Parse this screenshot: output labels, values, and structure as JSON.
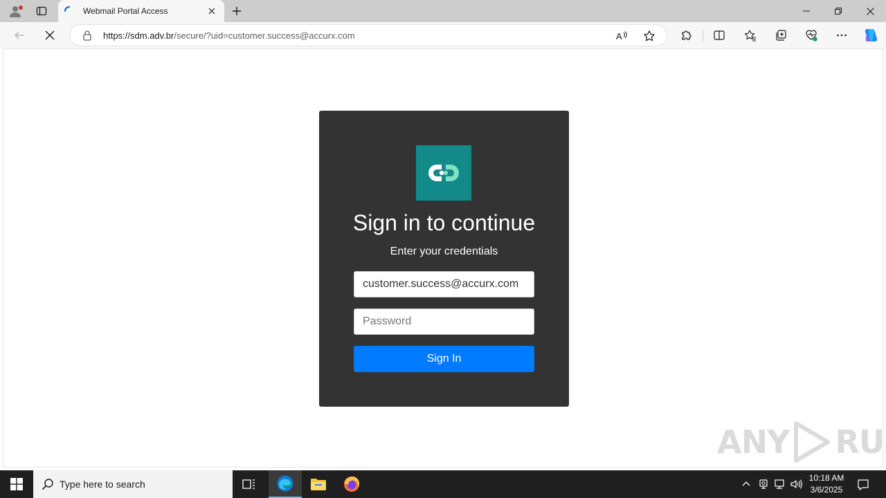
{
  "browser": {
    "tab_title": "Webmail Portal Access",
    "url_host": "https://sdm.adv.br",
    "url_path": "/secure/?uid=customer.success@accurx.com"
  },
  "page": {
    "heading": "Sign in to continue",
    "subheading": "Enter your credentials",
    "email_value": "customer.success@accurx.com",
    "password_placeholder": "Password",
    "signin_label": "Sign In",
    "logo_color": "#138a8a",
    "button_color": "#007bff",
    "card_color": "#333333"
  },
  "watermark": {
    "left": "ANY",
    "right": "RUN"
  },
  "taskbar": {
    "search_placeholder": "Type here to search",
    "time": "10:18 AM",
    "date": "3/6/2025"
  }
}
